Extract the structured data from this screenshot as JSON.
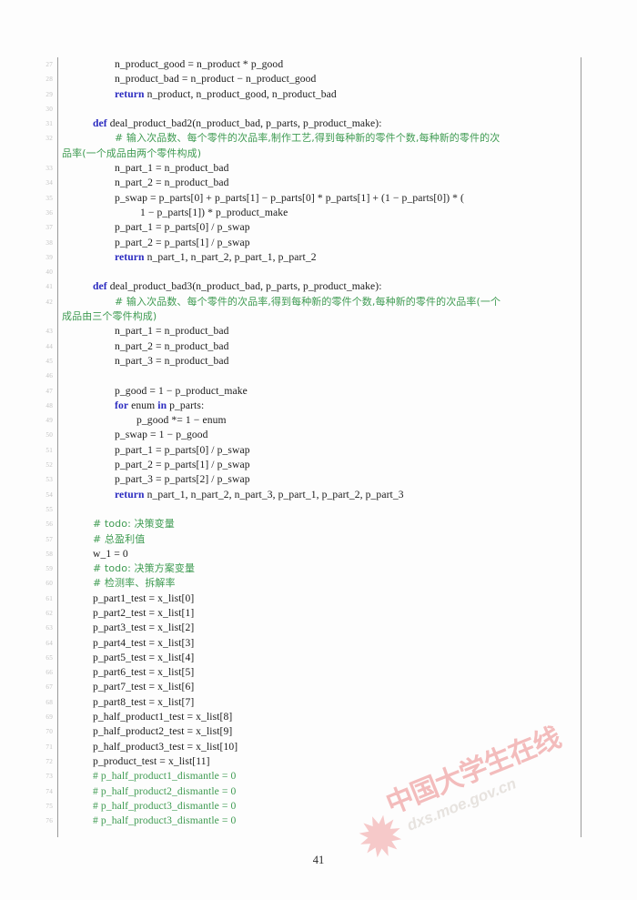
{
  "document": {
    "page_number": "41",
    "colors": {
      "keyword": "#2b2bc0",
      "comment": "#3f9b52",
      "text": "#1a1a1a",
      "line_number": "#c3c3c3",
      "rule": "#9a9a9a",
      "watermark_red": "#f3bcbc"
    }
  },
  "watermark": {
    "star_glyph": "✹",
    "chinese_text": "中国大学生在线",
    "url_text": "dxs.moe.gov.cn"
  },
  "listing": {
    "lines": [
      {
        "no": "27",
        "indent": 2,
        "text": "n_product_good = n_product * p_good"
      },
      {
        "no": "28",
        "indent": 2,
        "text": "n_product_bad = n_product − n_product_good"
      },
      {
        "no": "29",
        "indent": 2,
        "kw": "return",
        "text": " n_product, n_product_good, n_product_bad"
      },
      {
        "no": "30",
        "indent": 0,
        "text": ""
      },
      {
        "no": "31",
        "indent": 1,
        "kw": "def",
        "text": " deal_product_bad2(n_product_bad, p_parts, p_product_make):"
      },
      {
        "no": "32",
        "indent": 2,
        "comment": "# 输入次品数、每个零件的次品率,制作工艺,得到每种新的零件个数,每种新的零件的次"
      },
      {
        "no": "",
        "cont": true,
        "comment": "品率(一个成品由两个零件构成)"
      },
      {
        "no": "33",
        "indent": 2,
        "text": "n_part_1 = n_product_bad"
      },
      {
        "no": "34",
        "indent": 2,
        "text": "n_part_2 = n_product_bad"
      },
      {
        "no": "35",
        "indent": 2,
        "text": "p_swap = p_parts[0] + p_parts[1] − p_parts[0] * p_parts[1] + (1 − p_parts[0]) * ("
      },
      {
        "no": "36",
        "indent": 4,
        "text": "1 − p_parts[1]) * p_product_make"
      },
      {
        "no": "37",
        "indent": 2,
        "text": "p_part_1 = p_parts[0] / p_swap"
      },
      {
        "no": "38",
        "indent": 2,
        "text": "p_part_2 = p_parts[1] / p_swap"
      },
      {
        "no": "39",
        "indent": 2,
        "kw": "return",
        "text": " n_part_1, n_part_2, p_part_1, p_part_2"
      },
      {
        "no": "40",
        "indent": 0,
        "text": ""
      },
      {
        "no": "41",
        "indent": 1,
        "kw": "def",
        "text": " deal_product_bad3(n_product_bad, p_parts, p_product_make):"
      },
      {
        "no": "42",
        "indent": 2,
        "comment": "# 输入次品数、每个零件的次品率,得到每种新的零件个数,每种新的零件的次品率(一个"
      },
      {
        "no": "",
        "cont": true,
        "comment": "成品由三个零件构成)"
      },
      {
        "no": "43",
        "indent": 2,
        "text": "n_part_1 = n_product_bad"
      },
      {
        "no": "44",
        "indent": 2,
        "text": "n_part_2 = n_product_bad"
      },
      {
        "no": "45",
        "indent": 2,
        "text": "n_part_3 = n_product_bad"
      },
      {
        "no": "46",
        "indent": 0,
        "text": ""
      },
      {
        "no": "47",
        "indent": 2,
        "text": "p_good = 1 − p_product_make"
      },
      {
        "no": "48",
        "indent": 2,
        "kw": "for",
        "text": " enum ",
        "kw2": "in",
        "text2": " p_parts:"
      },
      {
        "no": "49",
        "indent": 3,
        "text": "p_good *= 1 − enum"
      },
      {
        "no": "50",
        "indent": 2,
        "text": "p_swap = 1 − p_good"
      },
      {
        "no": "51",
        "indent": 2,
        "text": "p_part_1 = p_parts[0] / p_swap"
      },
      {
        "no": "52",
        "indent": 2,
        "text": "p_part_2 = p_parts[1] / p_swap"
      },
      {
        "no": "53",
        "indent": 2,
        "text": "p_part_3 = p_parts[2] / p_swap"
      },
      {
        "no": "54",
        "indent": 2,
        "kw": "return",
        "text": " n_part_1, n_part_2, n_part_3, p_part_1, p_part_2, p_part_3"
      },
      {
        "no": "55",
        "indent": 0,
        "text": ""
      },
      {
        "no": "56",
        "indent": 1,
        "comment": "# todo: 决策变量"
      },
      {
        "no": "57",
        "indent": 1,
        "comment": "# 总盈利值"
      },
      {
        "no": "58",
        "indent": 1,
        "text": "w_1 = 0"
      },
      {
        "no": "59",
        "indent": 1,
        "comment": "# todo: 决策方案变量"
      },
      {
        "no": "60",
        "indent": 1,
        "comment": "# 检测率、拆解率"
      },
      {
        "no": "61",
        "indent": 1,
        "text": "p_part1_test = x_list[0]"
      },
      {
        "no": "62",
        "indent": 1,
        "text": "p_part2_test = x_list[1]"
      },
      {
        "no": "63",
        "indent": 1,
        "text": "p_part3_test = x_list[2]"
      },
      {
        "no": "64",
        "indent": 1,
        "text": "p_part4_test = x_list[3]"
      },
      {
        "no": "65",
        "indent": 1,
        "text": "p_part5_test = x_list[4]"
      },
      {
        "no": "66",
        "indent": 1,
        "text": "p_part6_test = x_list[5]"
      },
      {
        "no": "67",
        "indent": 1,
        "text": "p_part7_test = x_list[6]"
      },
      {
        "no": "68",
        "indent": 1,
        "text": "p_part8_test = x_list[7]"
      },
      {
        "no": "69",
        "indent": 1,
        "text": "p_half_product1_test = x_list[8]"
      },
      {
        "no": "70",
        "indent": 1,
        "text": "p_half_product2_test = x_list[9]"
      },
      {
        "no": "71",
        "indent": 1,
        "text": "p_half_product3_test = x_list[10]"
      },
      {
        "no": "72",
        "indent": 1,
        "text": "p_product_test = x_list[11]"
      },
      {
        "no": "73",
        "indent": 1,
        "comment": "# p_half_product1_dismantle = 0"
      },
      {
        "no": "74",
        "indent": 1,
        "comment": "# p_half_product2_dismantle = 0"
      },
      {
        "no": "75",
        "indent": 1,
        "comment": "# p_half_product3_dismantle = 0"
      },
      {
        "no": "76",
        "indent": 1,
        "comment": "# p_half_product3_dismantle = 0"
      }
    ]
  }
}
